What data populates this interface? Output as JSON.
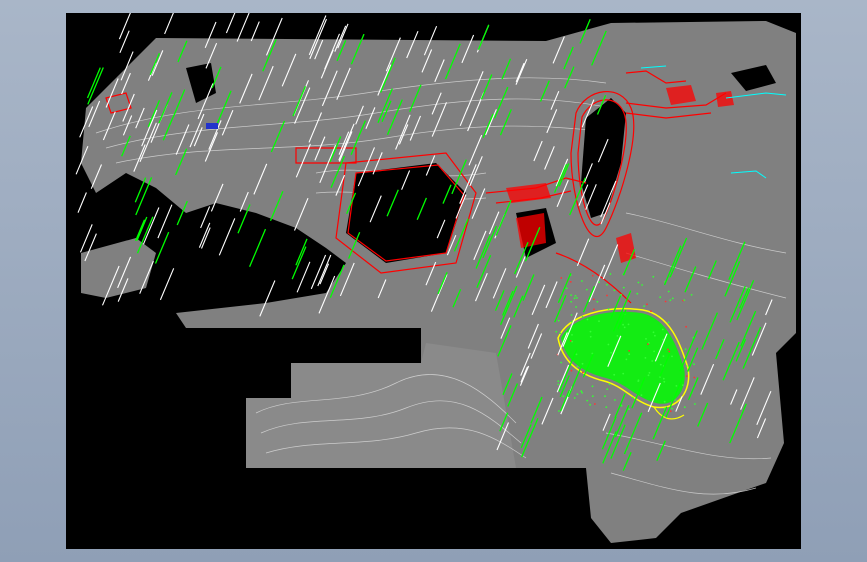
{
  "viewport": {
    "background": "#000000",
    "frame_color": "#9aa8bd"
  },
  "drawing": {
    "terrain_color": "#808080",
    "contour_color": "#d9d9d9",
    "red_linework_color": "#ff0000",
    "green_hatch_color": "#00ff00",
    "yellow_boundary_color": "#ffff00",
    "cyan_linework_color": "#00ffff",
    "white_stroke_color": "#ffffff"
  }
}
